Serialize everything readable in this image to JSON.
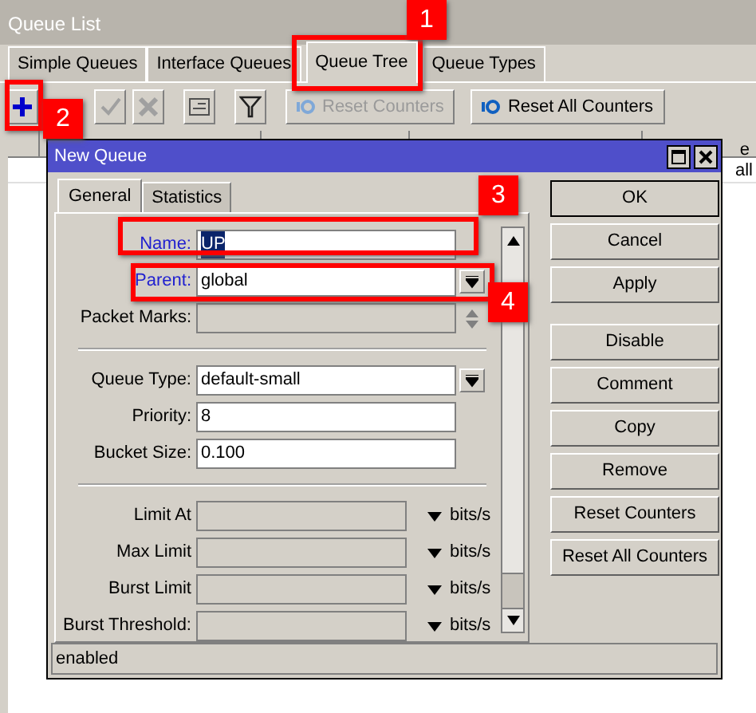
{
  "window": {
    "title": "Queue List"
  },
  "tabs": [
    {
      "label": "Simple Queues",
      "selected": false
    },
    {
      "label": "Interface Queues",
      "selected": false
    },
    {
      "label": "Queue Tree",
      "selected": true
    },
    {
      "label": "Queue Types",
      "selected": false
    }
  ],
  "toolbar": {
    "buttons": [
      {
        "label": "Reset Counters",
        "disabled": true
      },
      {
        "label": "Reset All Counters",
        "disabled": false
      }
    ]
  },
  "table": {
    "columns": [
      {
        "label": "e"
      }
    ],
    "rows": [
      {
        "cells": [
          "all"
        ]
      }
    ]
  },
  "dialog": {
    "title": "New Queue",
    "tabs": [
      {
        "label": "General",
        "selected": true
      },
      {
        "label": "Statistics",
        "selected": false
      }
    ],
    "sections": [
      [
        {
          "kind": "text",
          "label": "Name:",
          "value": "UP",
          "required": true,
          "text_selected": true,
          "disabled": false
        },
        {
          "kind": "dropdown",
          "label": "Parent:",
          "value": "global",
          "required": true,
          "disabled": false
        },
        {
          "kind": "multi",
          "label": "Packet Marks:",
          "required": false,
          "disabled": true
        }
      ],
      [
        {
          "kind": "dropdown",
          "label": "Queue Type:",
          "value": "default-small",
          "required": false,
          "disabled": false
        },
        {
          "kind": "text",
          "label": "Priority:",
          "value": "8",
          "required": false,
          "text_selected": false,
          "disabled": false
        },
        {
          "kind": "text",
          "label": "Bucket Size:",
          "value": "0.100",
          "required": false,
          "text_selected": false,
          "disabled": false
        }
      ],
      [
        {
          "kind": "rate",
          "label": "Limit At",
          "unit": "bits/s",
          "required": false,
          "disabled": true
        },
        {
          "kind": "rate",
          "label": "Max Limit",
          "unit": "bits/s",
          "required": false,
          "disabled": true
        },
        {
          "kind": "rate",
          "label": "Burst Limit",
          "unit": "bits/s",
          "required": false,
          "disabled": true
        },
        {
          "kind": "rate",
          "label": "Burst Threshold:",
          "unit": "bits/s",
          "required": false,
          "disabled": true
        }
      ]
    ],
    "buttons": [
      {
        "label": "OK",
        "default": true
      },
      {
        "label": "Cancel",
        "default": false
      },
      {
        "label": "Apply",
        "default": false
      },
      {
        "label": "Disable",
        "default": false
      },
      {
        "label": "Comment",
        "default": false
      },
      {
        "label": "Copy",
        "default": false
      },
      {
        "label": "Remove",
        "default": false
      },
      {
        "label": "Reset Counters",
        "default": false
      },
      {
        "label": "Reset All Counters",
        "default": false
      }
    ],
    "status": "enabled"
  },
  "annotations": [
    {
      "number": "1"
    },
    {
      "number": "2"
    },
    {
      "number": "3"
    },
    {
      "number": "4"
    }
  ]
}
